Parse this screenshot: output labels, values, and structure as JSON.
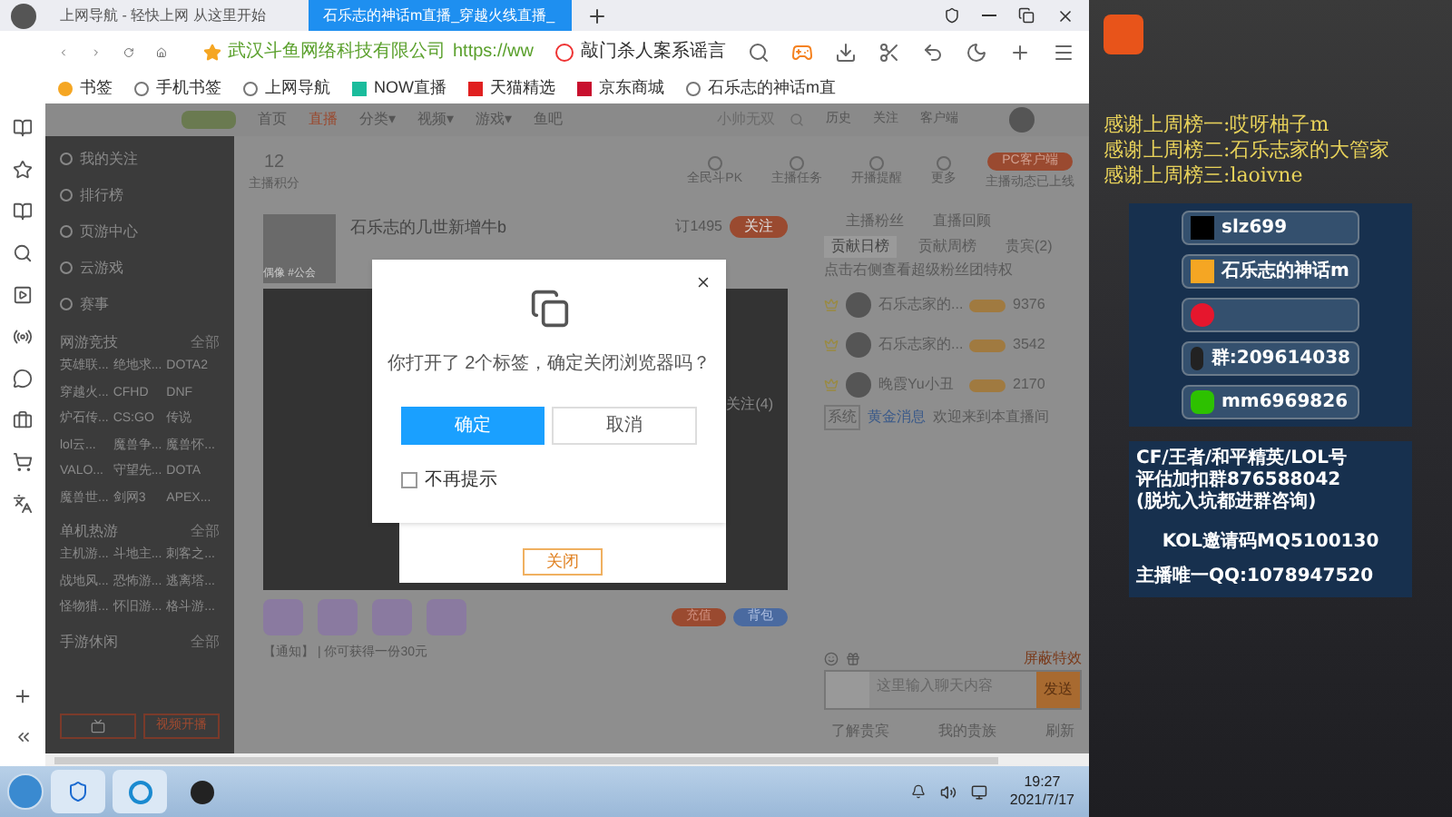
{
  "browser": {
    "tabs": [
      {
        "title": "上网导航 - 轻快上网 从这里开始",
        "selected": false
      },
      {
        "title": "石乐志的神话m直播_穿越火线直播_",
        "selected": true
      }
    ],
    "address": {
      "site": "武汉斗鱼网络科技有限公司",
      "url": "https://ww",
      "search_hint": "敲门杀人案系谣言"
    },
    "bookmarks": [
      "书签",
      "手机书签",
      "上网导航",
      "NOW直播",
      "天猫精选",
      "京东商城",
      "石乐志的神话m直"
    ]
  },
  "page": {
    "nav": [
      {
        "label": "首页",
        "selected": false
      },
      {
        "label": "直播",
        "selected": true
      },
      {
        "label": "分类▾",
        "selected": false
      },
      {
        "label": "视频▾",
        "selected": false
      },
      {
        "label": "游戏▾",
        "selected": false
      },
      {
        "label": "鱼吧",
        "selected": false
      }
    ],
    "search_placeholder": "小帅无双",
    "nav_actions": [
      "历史",
      "关注",
      "客户端"
    ],
    "sidebar": {
      "items": [
        "我的关注",
        "排行榜",
        "页游中心",
        "云游戏",
        "赛事"
      ],
      "sections": [
        {
          "title": "网游竞技",
          "more": "全部",
          "games": [
            "英雄联...",
            "绝地求...",
            "DOTA2",
            "穿越火...",
            "CFHD",
            "DNF",
            "炉石传...",
            "CS:GO",
            "传说",
            "lol云...",
            "魔兽争...",
            "魔兽怀...",
            "VALO...",
            "守望先...",
            "DOTA",
            "魔兽世...",
            "剑网3",
            "APEX..."
          ]
        },
        {
          "title": "单机热游",
          "more": "全部",
          "games": [
            "主机游...",
            "斗地主...",
            "刺客之...",
            "战地风...",
            "恐怖游...",
            "逃离塔...",
            "怪物猎...",
            "怀旧游...",
            "格斗游..."
          ]
        },
        {
          "title": "手游休闲",
          "more": "全部"
        }
      ],
      "button": "视频开播"
    },
    "stats": [
      {
        "value": "12",
        "label": "主播积分"
      }
    ],
    "actions": [
      "全民斗PK",
      "主播任务",
      "开播提醒",
      "更多"
    ],
    "pc_button": "PC客户端",
    "pc_note": "主播动态已上线",
    "streamer": {
      "name": "石乐志的几世新增牛b",
      "tag": "偶像 #公会",
      "followers": "订1495",
      "follow": "关注",
      "fans": "关注(4)"
    },
    "notice": "【通知】 | 你可获得一份30元",
    "gift_buttons": [
      "充值",
      "背包"
    ],
    "chat": {
      "tabs": [
        {
          "label": "主播粉丝",
          "selected": false
        },
        {
          "label": "直播回顾",
          "selected": false
        }
      ],
      "rank_tabs": [
        {
          "label": "贡献日榜",
          "selected": true
        },
        {
          "label": "贡献周榜",
          "selected": false
        },
        {
          "label": "贵宾(2)",
          "selected": false
        }
      ],
      "hint": "点击右侧查看超级粉丝团特权",
      "ranks": [
        {
          "name": "石乐志家的...",
          "score": "9376"
        },
        {
          "name": "石乐志家的...",
          "score": "3542"
        },
        {
          "name": "晚霞Yu小丑",
          "score": "2170"
        }
      ],
      "system": {
        "tag": "系统",
        "user": "黄金消息",
        "text": "欢迎来到本直播间"
      },
      "input_placeholder": "这里输入聊天内容",
      "send": "发送",
      "report": "屏蔽特效",
      "footer": [
        "了解贵宾",
        "我的贵族",
        "刷新"
      ]
    }
  },
  "dialog": {
    "message": "你打开了 2个标签，确定关闭浏览器吗？",
    "confirm": "确定",
    "cancel": "取消",
    "dont_show": {
      "label": "不再提示",
      "checked": false
    },
    "behind_button": "关闭"
  },
  "overlay": {
    "thanks": [
      "感谢上周榜一:哎呀柚子m",
      "感谢上周榜二:石乐志家的大管家",
      "感谢上周榜三:laoivne"
    ],
    "contacts": [
      {
        "kind": "douyin",
        "text": "slz699"
      },
      {
        "kind": "huya",
        "text": "石乐志的神话m"
      },
      {
        "kind": "weibo"
      },
      {
        "kind": "qq",
        "text": "群:209614038"
      },
      {
        "kind": "wechat",
        "text": "mm6969826"
      }
    ],
    "info": [
      "CF/王者/和平精英/LOL号",
      "评估加扣群876588042",
      "(脱坑入坑都进群咨询)"
    ],
    "kol": "KOL邀请码MQ5100130",
    "qq": "主播唯一QQ:1078947520"
  },
  "taskbar": {
    "time": "19:27",
    "date": "2021/7/17"
  }
}
